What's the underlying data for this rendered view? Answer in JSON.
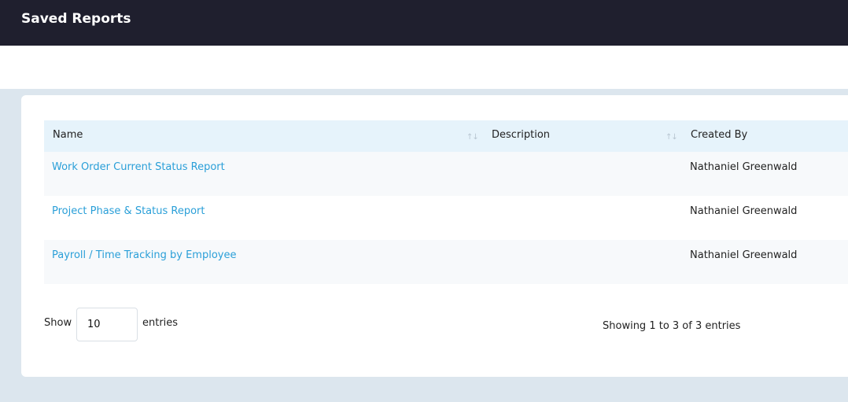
{
  "header": {
    "title": "Saved Reports"
  },
  "table": {
    "columns": [
      {
        "label": "Name",
        "sortable": true
      },
      {
        "label": "Description",
        "sortable": true
      },
      {
        "label": "Created By",
        "sortable": false
      }
    ],
    "sort_icon": "sort-arrows-icon",
    "rows": [
      {
        "name": "Work Order Current Status Report",
        "description": "",
        "created_by": "Nathaniel Greenwald"
      },
      {
        "name": "Project Phase & Status Report",
        "description": "",
        "created_by": "Nathaniel Greenwald"
      },
      {
        "name": "Payroll / Time Tracking by Employee",
        "description": "",
        "created_by": "Nathaniel Greenwald"
      }
    ]
  },
  "pagination": {
    "show_label": "Show",
    "page_length": "10",
    "entries_label": "entries",
    "info": "Showing 1 to 3 of 3 entries"
  },
  "colors": {
    "topbar": "#1f1f2e",
    "link": "#2a9fd8",
    "table_header": "#e6f3fb",
    "page_background": "#dce6ee"
  }
}
